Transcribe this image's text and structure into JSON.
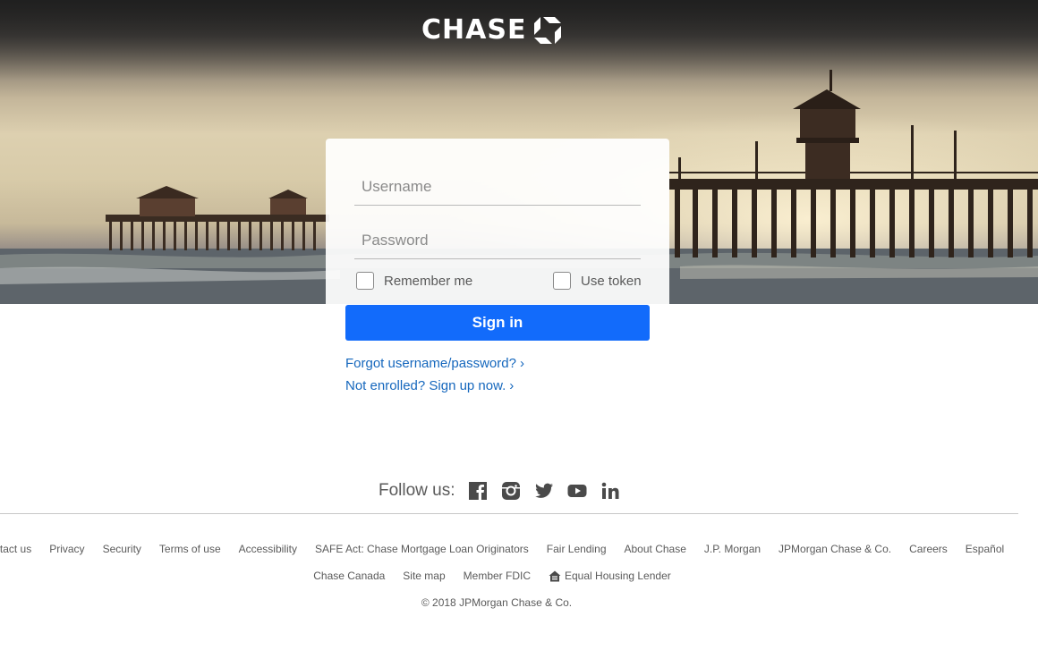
{
  "header": {
    "logo_text": "CHASE",
    "logo_icon": "chase-octagon-logo-icon"
  },
  "login": {
    "username_placeholder": "Username",
    "password_placeholder": "Password",
    "remember_me_label": "Remember me",
    "use_token_label": "Use token",
    "sign_in_label": "Sign in",
    "forgot_link": "Forgot username/password?",
    "enroll_link": "Not enrolled? Sign up now."
  },
  "follow": {
    "label": "Follow us:",
    "icons": [
      "facebook-icon",
      "instagram-icon",
      "twitter-icon",
      "youtube-icon",
      "linkedin-icon"
    ]
  },
  "footer": {
    "row1": [
      "Contact us",
      "Privacy",
      "Security",
      "Terms of use",
      "Accessibility",
      "SAFE Act: Chase Mortgage Loan Originators",
      "Fair Lending",
      "About Chase",
      "J.P. Morgan",
      "JPMorgan Chase & Co.",
      "Careers",
      "Español"
    ],
    "row2": [
      "Chase Canada",
      "Site map",
      "Member FDIC",
      "Equal Housing Lender"
    ],
    "copyright": "© 2018 JPMorgan Chase & Co."
  },
  "colors": {
    "primary_button": "#126bfb",
    "link": "#1567bd",
    "text": "#5a5a5a"
  }
}
